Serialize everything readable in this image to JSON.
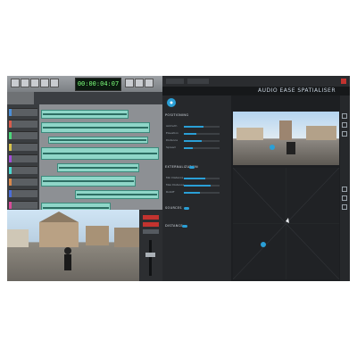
{
  "daw": {
    "counter": "00:00:04:07",
    "tracks": [
      {
        "color": "#4c8fd8"
      },
      {
        "color": "#d85c4c"
      },
      {
        "color": "#4cd87a"
      },
      {
        "color": "#d8c44c"
      },
      {
        "color": "#a44cd8"
      },
      {
        "color": "#4cd8d0"
      },
      {
        "color": "#d8884c"
      },
      {
        "color": "#4c6ed8"
      },
      {
        "color": "#d84c9a"
      },
      {
        "color": "#8ad84c"
      },
      {
        "color": "#4c8fd8"
      },
      {
        "color": "#d85c4c"
      },
      {
        "color": "#4cd87a"
      },
      {
        "color": "#d8c44c"
      }
    ]
  },
  "plugin": {
    "brand": "AUDIO EASE SPATIALISER",
    "sections": {
      "positioning": "POSITIONING",
      "externalization": "EXTERNALIZATION",
      "sources": "SOURCES",
      "distance": "DISTANCE"
    },
    "params": {
      "azimuth": "Azimuth",
      "elevation": "Elevation",
      "distance": "Distance",
      "spread": "Spread",
      "min_distance": "Min Distance",
      "max_distance": "Max Distance",
      "rolloff": "Rolloff"
    },
    "param_values": {
      "azimuth": 0.55,
      "elevation": 0.35,
      "distance": 0.5,
      "spread": 0.25,
      "min_distance": 0.6,
      "max_distance": 0.75,
      "rolloff": 0.45
    },
    "accent": "#2a9fd6"
  }
}
